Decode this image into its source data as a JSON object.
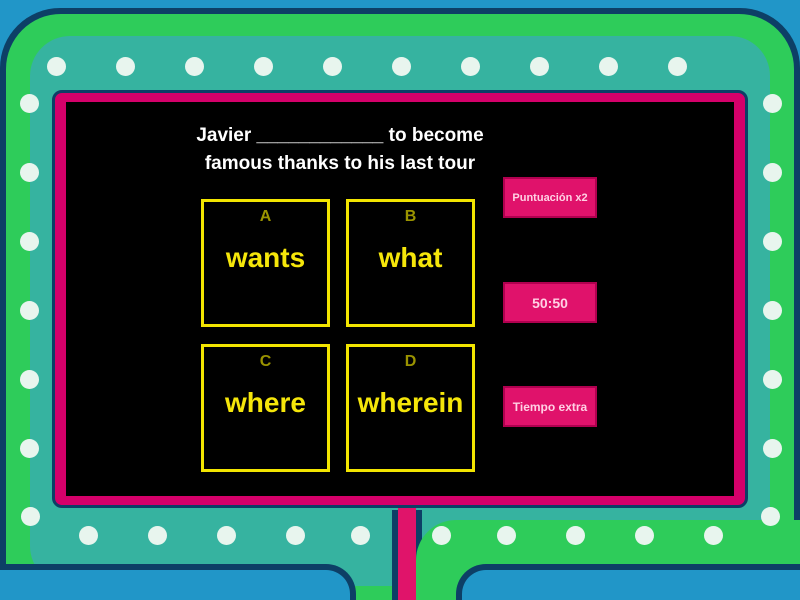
{
  "question": {
    "line1": "Javier ____________ to become",
    "line2": "famous thanks to his last tour"
  },
  "answers": [
    {
      "letter": "A",
      "text": "wants"
    },
    {
      "letter": "B",
      "text": "what"
    },
    {
      "letter": "C",
      "text": "where"
    },
    {
      "letter": "D",
      "text": "wherein"
    }
  ],
  "powerups": {
    "double_score": "Puntuación x2",
    "fifty_fifty": "50:50",
    "extra_time": "Tiempo extra"
  },
  "colors": {
    "background": "#2196c8",
    "frame_green": "#2ecc5a",
    "frame_teal": "#36b3a0",
    "screen_border": "#d5006a",
    "answer_yellow": "#f2e500",
    "powerup_pink": "#e0126b"
  }
}
